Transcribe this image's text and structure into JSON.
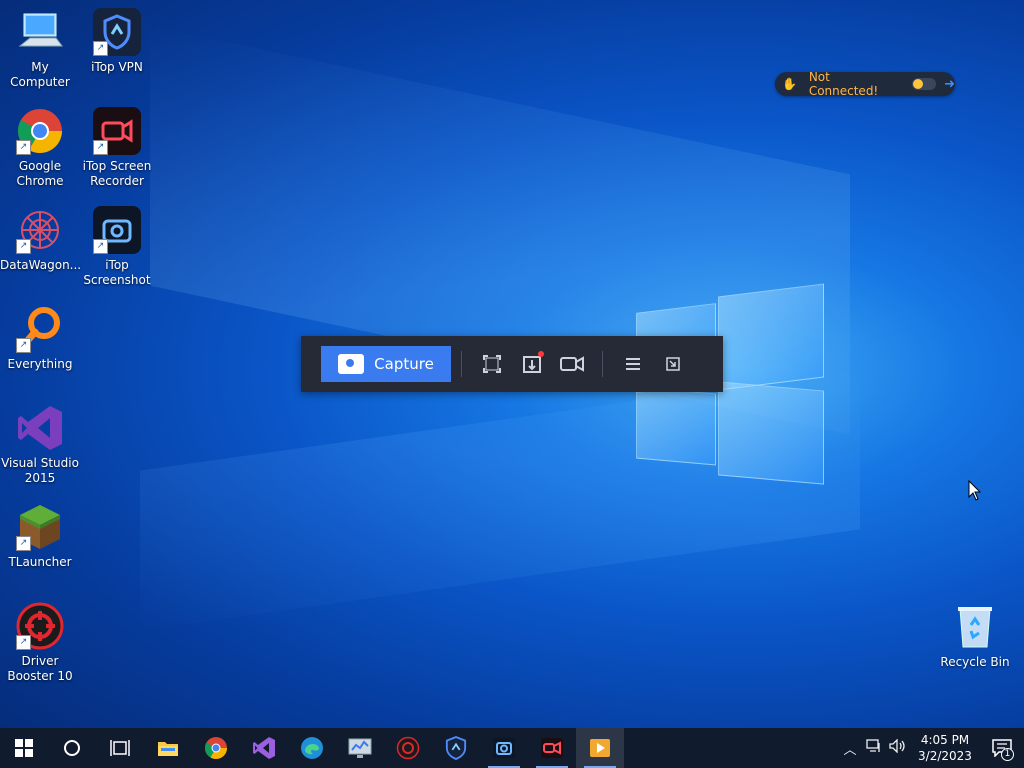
{
  "desktop": {
    "icons": [
      {
        "label": "My Computer"
      },
      {
        "label": "iTop VPN"
      },
      {
        "label": "Google Chrome"
      },
      {
        "label": "iTop Screen Recorder"
      },
      {
        "label": "DataWagon..."
      },
      {
        "label": "iTop Screenshot"
      },
      {
        "label": "Everything"
      },
      {
        "label": "Visual Studio 2015"
      },
      {
        "label": "TLauncher"
      },
      {
        "label": "Driver Booster 10"
      }
    ],
    "recycle_bin": {
      "label": "Recycle Bin"
    }
  },
  "vpn_widget": {
    "status": "Not Connected!",
    "color": "#ffb648"
  },
  "capture_toolbar": {
    "capture_label": "Capture",
    "accent": "#3a7bf0"
  },
  "taskbar": {
    "time": "4:05 PM",
    "date": "3/2/2023",
    "notification_count": "1"
  }
}
